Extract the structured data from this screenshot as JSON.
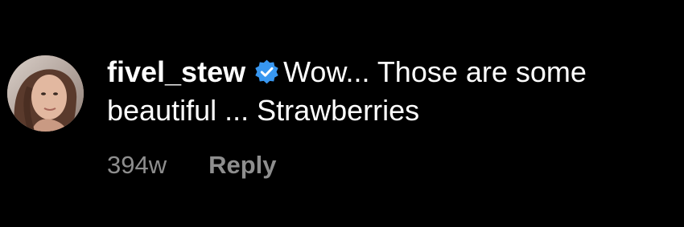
{
  "comment": {
    "username": "fivel_stew",
    "verified_icon": "verified-badge-icon",
    "text_line1": "Wow... Those are some",
    "text_line2": "beautiful ... Strawberries",
    "timestamp": "394w",
    "reply_label": "Reply"
  },
  "colors": {
    "background": "#000000",
    "text": "#ffffff",
    "muted": "#8e8e8e",
    "verified": "#3897f0"
  }
}
